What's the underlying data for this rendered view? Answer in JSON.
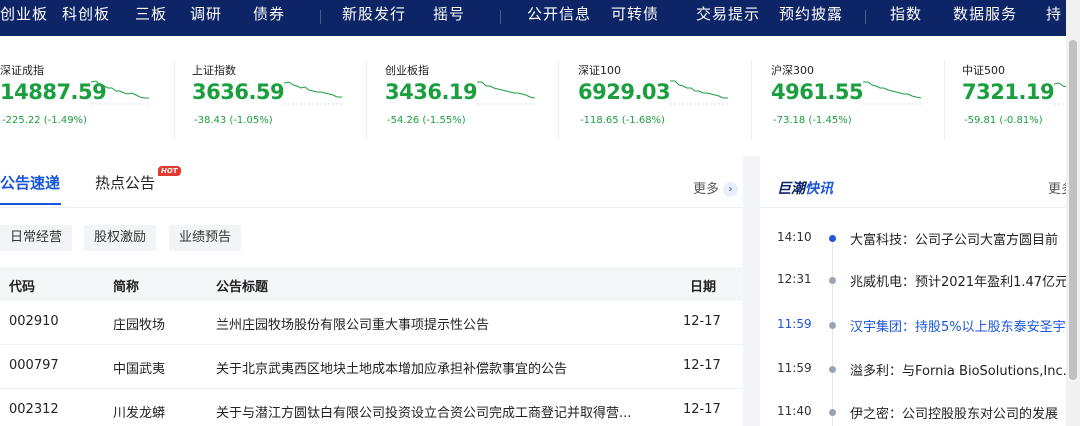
{
  "nav": [
    "创业板",
    "科创板",
    "三板",
    "调研",
    "债券",
    "新股发行",
    "摇号",
    "公开信息",
    "可转债",
    "交易提示",
    "预约披露",
    "指数",
    "数据服务",
    "持"
  ],
  "indices": [
    {
      "name": "深证成指",
      "value": "14887.59",
      "change": "-225.22 (-1.49%)"
    },
    {
      "name": "上证指数",
      "value": "3636.59",
      "change": "-38.43 (-1.05%)"
    },
    {
      "name": "创业板指",
      "value": "3436.19",
      "change": "-54.26 (-1.55%)"
    },
    {
      "name": "深证100",
      "value": "6929.03",
      "change": "-118.65 (-1.68%)"
    },
    {
      "name": "沪深300",
      "value": "4961.55",
      "change": "-73.18 (-1.45%)"
    },
    {
      "name": "中证500",
      "value": "7321.19",
      "change": "-59.81 (-0.81%)"
    }
  ],
  "colors": {
    "nav_bg": "#0d2466",
    "down": "#1b9e3e",
    "accent": "#1a56db",
    "hot": "#e23a2e"
  },
  "tabs": [
    {
      "label": "公告速递"
    },
    {
      "label": "热点公告"
    }
  ],
  "hot_badge": "HOT",
  "more_label": "更多",
  "filters": [
    "日常经营",
    "股权激励",
    "业绩预告"
  ],
  "table": {
    "headers": [
      "代码",
      "简称",
      "公告标题",
      "日期"
    ],
    "rows": [
      [
        "002910",
        "庄园牧场",
        "兰州庄园牧场股份有限公司重大事项提示性公告",
        "12-17"
      ],
      [
        "000797",
        "中国武夷",
        "关于北京武夷西区地块土地成本增加应承担补偿款事宜的公告",
        "12-17"
      ],
      [
        "002312",
        "川发龙蟒",
        "关于与潜江方圆钛白有限公司投资设立合资公司完成工商登记并取得营...",
        "12-17"
      ]
    ]
  },
  "flash": {
    "brand_a": "巨潮",
    "brand_b": "快讯",
    "more_label": "更多",
    "items": [
      {
        "time": "14:10",
        "text": "大富科技：公司子公司大富方圆目前",
        "active_dot": true,
        "highlight": false
      },
      {
        "time": "12:31",
        "text": "兆威机电：预计2021年盈利1.47亿元",
        "active_dot": false,
        "highlight": false
      },
      {
        "time": "11:59",
        "text": "汉宇集团：持股5%以上股东泰安圣宇",
        "active_dot": false,
        "highlight": true
      },
      {
        "time": "11:59",
        "text": "溢多利：与Fornia BioSolutions,Inc.",
        "active_dot": false,
        "highlight": false
      },
      {
        "time": "11:40",
        "text": "伊之密：公司控股股东对公司的发展",
        "active_dot": false,
        "highlight": false
      }
    ]
  }
}
